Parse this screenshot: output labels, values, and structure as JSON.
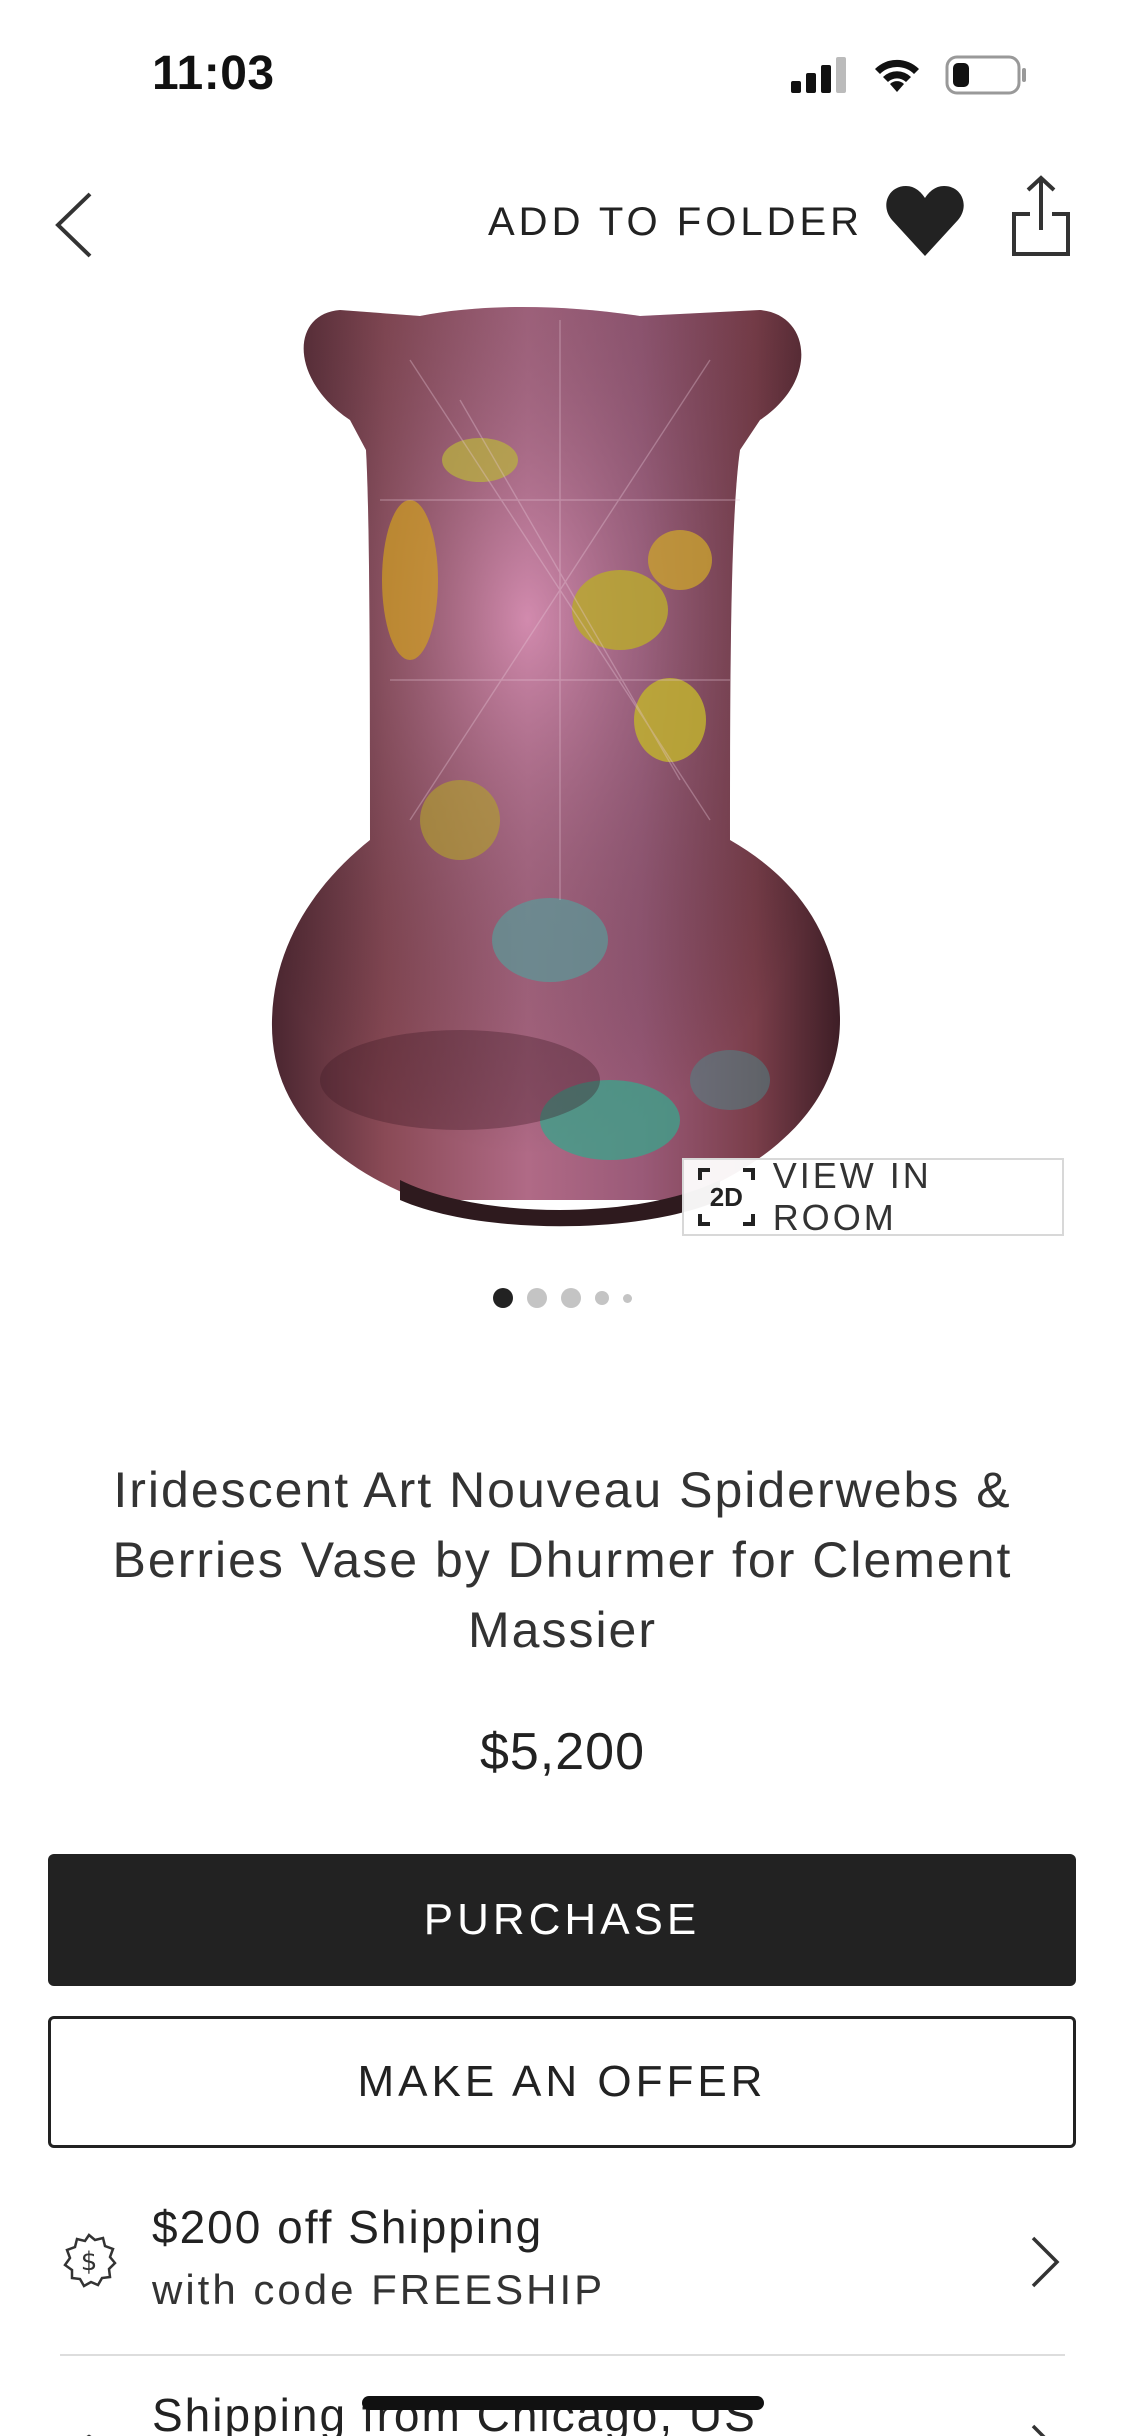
{
  "status_bar": {
    "time": "11:03"
  },
  "nav": {
    "add_to_folder": "ADD TO FOLDER",
    "back_icon": "chevron-left-icon",
    "favorite_icon": "heart-icon",
    "share_icon": "share-icon"
  },
  "gallery": {
    "image_subject": "iridescent vase",
    "view_room_badge": "2D",
    "view_room_label": "VIEW IN ROOM",
    "page_count": 5,
    "current_page": 1
  },
  "product": {
    "title": "Iridescent Art Nouveau Spiderwebs & Berries Vase by Dhurmer for Clement Massier",
    "price": "$5,200"
  },
  "actions": {
    "purchase": "PURCHASE",
    "offer": "MAKE AN OFFER"
  },
  "promo": {
    "title": "$200 off Shipping",
    "subtitle": "with code FREESHIP",
    "icon": "dollar-badge-icon"
  },
  "shipping": {
    "label": "Shipping from Chicago, US",
    "icon": "shipping-icon"
  },
  "colors": {
    "primary_button": "#222222",
    "text": "#222222",
    "dot_active": "#222222",
    "dot_inactive": "#c4c4c4"
  }
}
